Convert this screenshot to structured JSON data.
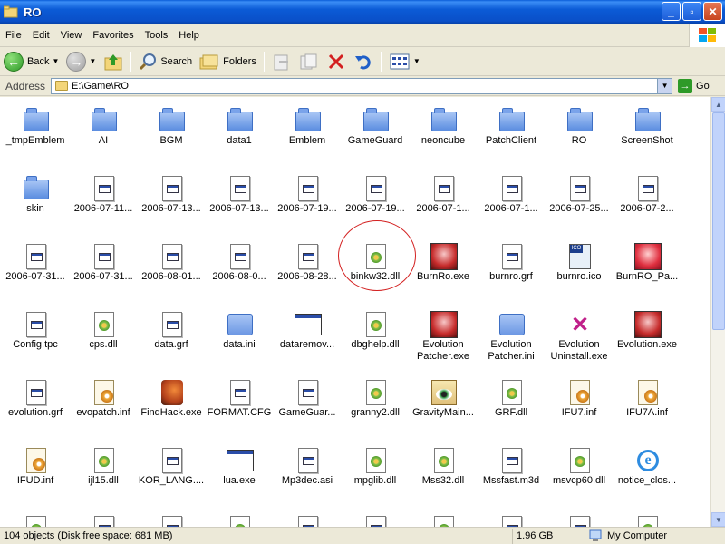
{
  "window": {
    "title": "RO"
  },
  "menu": [
    "File",
    "Edit",
    "View",
    "Favorites",
    "Tools",
    "Help"
  ],
  "toolbar": {
    "back": "Back",
    "search": "Search",
    "folders": "Folders"
  },
  "address": {
    "label": "Address",
    "path": "E:\\Game\\RO",
    "go": "Go"
  },
  "items": [
    {
      "name": "_tmpEmblem",
      "icon": "folder-icon"
    },
    {
      "name": "AI",
      "icon": "folder-icon"
    },
    {
      "name": "BGM",
      "icon": "folder-icon"
    },
    {
      "name": "data1",
      "icon": "folder-icon"
    },
    {
      "name": "Emblem",
      "icon": "folder-icon"
    },
    {
      "name": "GameGuard",
      "icon": "folder-icon"
    },
    {
      "name": "neoncube",
      "icon": "folder-icon"
    },
    {
      "name": "PatchClient",
      "icon": "folder-icon"
    },
    {
      "name": "RO",
      "icon": "folder-icon"
    },
    {
      "name": "ScreenShot",
      "icon": "folder-icon"
    },
    {
      "name": "skin",
      "icon": "folder-icon"
    },
    {
      "name": "2006-07-11...",
      "icon": "file-icon"
    },
    {
      "name": "2006-07-13...",
      "icon": "file-icon"
    },
    {
      "name": "2006-07-13...",
      "icon": "file-icon"
    },
    {
      "name": "2006-07-19...",
      "icon": "file-icon"
    },
    {
      "name": "2006-07-19...",
      "icon": "file-icon"
    },
    {
      "name": "2006-07-1...",
      "icon": "file-icon"
    },
    {
      "name": "2006-07-1...",
      "icon": "file-icon"
    },
    {
      "name": "2006-07-25...",
      "icon": "file-icon"
    },
    {
      "name": "2006-07-2...",
      "icon": "file-icon"
    },
    {
      "name": "2006-07-31...",
      "icon": "file-icon"
    },
    {
      "name": "2006-07-31...",
      "icon": "file-icon"
    },
    {
      "name": "2006-08-01...",
      "icon": "file-icon"
    },
    {
      "name": "2006-08-0...",
      "icon": "file-icon"
    },
    {
      "name": "2006-08-28...",
      "icon": "file-icon"
    },
    {
      "name": "binkw32.dll",
      "icon": "dll-icon"
    },
    {
      "name": "BurnRo.exe",
      "icon": "ro-exe-icon"
    },
    {
      "name": "burnro.grf",
      "icon": "file-icon"
    },
    {
      "name": "burnro.ico",
      "icon": "ico-icon"
    },
    {
      "name": "BurnRO_Pa...",
      "icon": "ro-exe-red-icon"
    },
    {
      "name": "Config.tpc",
      "icon": "file-icon"
    },
    {
      "name": "cps.dll",
      "icon": "dll-icon"
    },
    {
      "name": "data.grf",
      "icon": "file-icon"
    },
    {
      "name": "data.ini",
      "icon": "ini-icon"
    },
    {
      "name": "dataremov...",
      "icon": "app-icon"
    },
    {
      "name": "dbghelp.dll",
      "icon": "dll-icon"
    },
    {
      "name": "Evolution Patcher.exe",
      "icon": "ro-exe-icon"
    },
    {
      "name": "Evolution Patcher.ini",
      "icon": "ini-icon"
    },
    {
      "name": "Evolution Uninstall.exe",
      "icon": "uninstall-icon"
    },
    {
      "name": "Evolution.exe",
      "icon": "ro-exe-icon"
    },
    {
      "name": "evolution.grf",
      "icon": "file-icon"
    },
    {
      "name": "evopatch.inf",
      "icon": "inf-icon"
    },
    {
      "name": "FindHack.exe",
      "icon": "findhack-icon"
    },
    {
      "name": "FORMAT.CFG",
      "icon": "file-icon"
    },
    {
      "name": "GameGuar...",
      "icon": "file-icon"
    },
    {
      "name": "granny2.dll",
      "icon": "dll-icon"
    },
    {
      "name": "GravityMain...",
      "icon": "jpg-icon"
    },
    {
      "name": "GRF.dll",
      "icon": "dll-icon"
    },
    {
      "name": "IFU7.inf",
      "icon": "inf-icon"
    },
    {
      "name": "IFU7A.inf",
      "icon": "inf-icon"
    },
    {
      "name": "IFUD.inf",
      "icon": "inf-icon"
    },
    {
      "name": "ijl15.dll",
      "icon": "dll-icon"
    },
    {
      "name": "KOR_LANG....",
      "icon": "file-icon"
    },
    {
      "name": "lua.exe",
      "icon": "app-icon"
    },
    {
      "name": "Mp3dec.asi",
      "icon": "file-icon"
    },
    {
      "name": "mpglib.dll",
      "icon": "dll-icon"
    },
    {
      "name": "Mss32.dll",
      "icon": "dll-icon"
    },
    {
      "name": "Mssfast.m3d",
      "icon": "file-icon"
    },
    {
      "name": "msvcp60.dll",
      "icon": "dll-icon"
    },
    {
      "name": "notice_clos...",
      "icon": "ie-icon"
    }
  ],
  "status": {
    "objects": "104 objects (Disk free space: 681 MB)",
    "size": "1.96 GB",
    "location": "My Computer"
  }
}
